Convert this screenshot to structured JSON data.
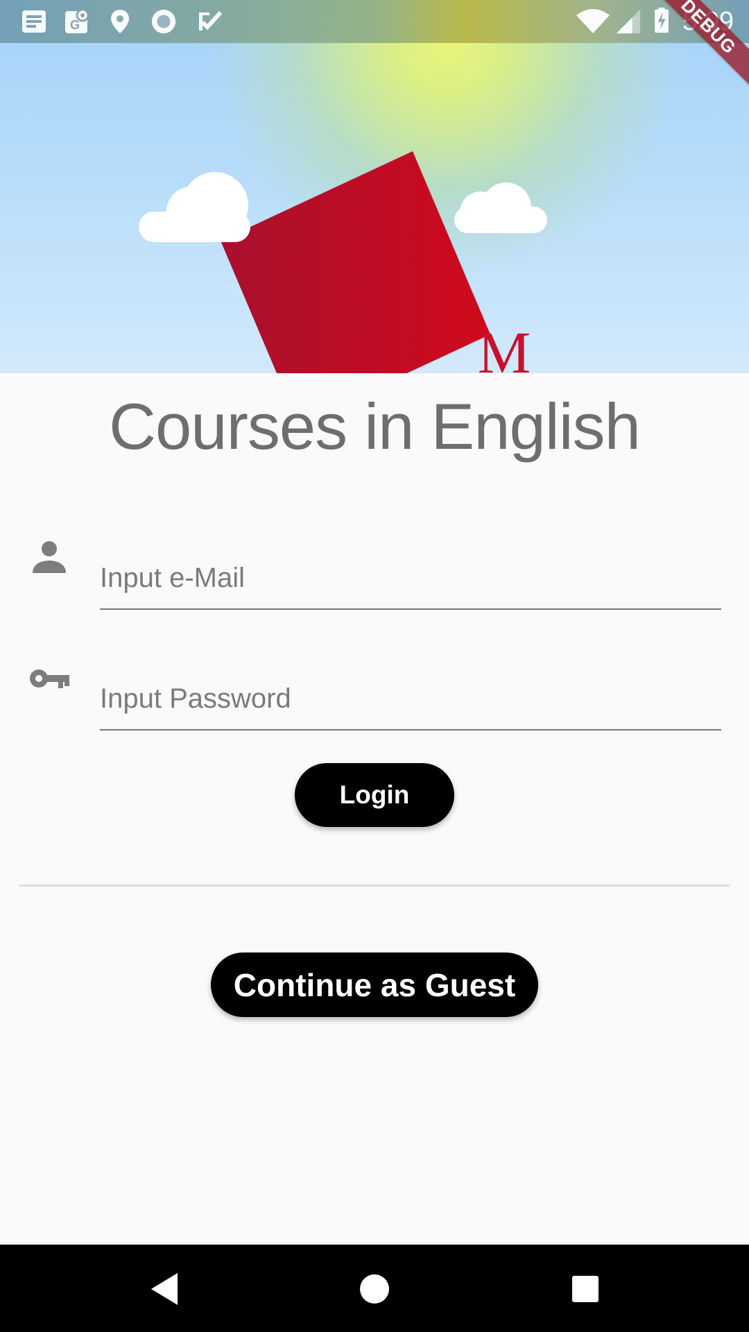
{
  "status_bar": {
    "time": "5:09",
    "left_icons": [
      "notes-icon",
      "maps-icon",
      "location-pin-icon",
      "record-circle-icon",
      "task-check-icon"
    ],
    "right_icons": [
      "wifi-icon",
      "cell-signal-icon",
      "battery-charging-icon"
    ]
  },
  "debug_banner": "DEBUG",
  "hero": {
    "logo_letter": "M",
    "logo_color": "#c8102e"
  },
  "title": "Courses in English",
  "email_field": {
    "placeholder": "Input e-Mail",
    "value": "",
    "icon": "person-icon"
  },
  "password_field": {
    "placeholder": "Input Password",
    "value": "",
    "icon": "key-icon"
  },
  "login_button": {
    "label": "Login"
  },
  "guest_button": {
    "label": "Continue as Guest"
  },
  "nav_bar": {
    "buttons": [
      "back-icon",
      "home-icon",
      "recents-icon"
    ]
  },
  "colors": {
    "accent": "#000000",
    "brand_red": "#c8102e",
    "background": "#fafafa"
  }
}
